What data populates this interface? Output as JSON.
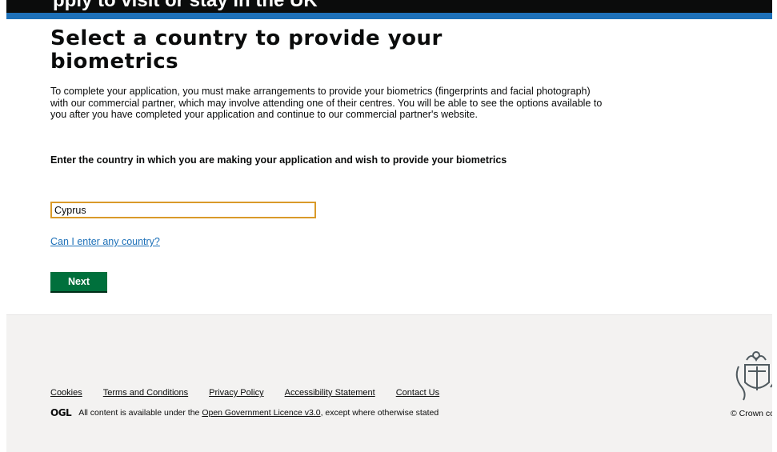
{
  "header": {
    "service_name": "pply to visit or stay in the UK"
  },
  "main": {
    "heading": "Select a country to provide your biometrics",
    "intro": "To complete your application, you must make arrangements to provide your biometrics (fingerprints and facial photograph) with our commercial partner, which may involve attending one of their centres. You will be able to see the options available to you after you have completed your application and continue to our commercial partner's website.",
    "country_label": "Enter the country in which you are making your application and wish to provide your biometrics",
    "country_value": "Cyprus",
    "help_link": "Can I enter any country?",
    "next_button": "Next"
  },
  "footer": {
    "links": [
      "Cookies",
      "Terms and Conditions",
      "Privacy Policy",
      "Accessibility Statement",
      "Contact Us"
    ],
    "ogl_logo": "OGL",
    "licence_prefix": "All content is available under the",
    "licence_link": "Open Government Licence v3.0",
    "licence_suffix": ", except where otherwise stated",
    "crown_copyright": "© Crown copyright"
  },
  "colors": {
    "header_bg": "#0b0c0c",
    "blue_bar": "#1d70b8",
    "link": "#1d70b8",
    "button": "#00703c",
    "focus_border": "#d99a2a",
    "footer_bg": "#f3f2f1"
  }
}
